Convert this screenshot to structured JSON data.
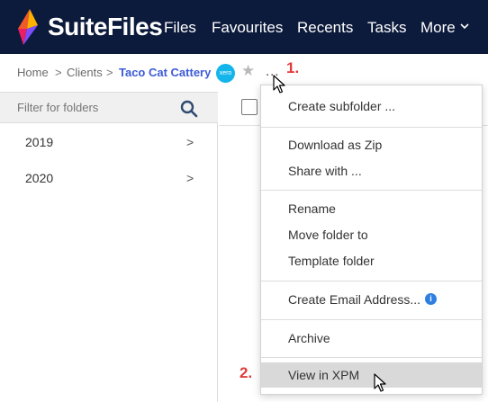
{
  "app": {
    "name": "SuiteFiles"
  },
  "nav": {
    "files": "Files",
    "favourites": "Favourites",
    "recents": "Recents",
    "tasks": "Tasks",
    "more": "More"
  },
  "breadcrumb": {
    "home": "Home",
    "clients": "Clients",
    "current": "Taco Cat Cattery",
    "separator": ">",
    "xero_badge": "xero",
    "more_dots": "..."
  },
  "annotations": {
    "step1": "1.",
    "step2": "2."
  },
  "filter": {
    "placeholder": "Filter for folders"
  },
  "folders": [
    {
      "label": "2019",
      "chevron": ">"
    },
    {
      "label": "2020",
      "chevron": ">"
    }
  ],
  "context_menu": {
    "create_subfolder": "Create subfolder ...",
    "download_zip": "Download as Zip",
    "share_with": "Share with ...",
    "rename": "Rename",
    "move_folder": "Move folder to",
    "template_folder": "Template folder",
    "create_email": "Create Email Address...",
    "info_glyph": "i",
    "archive": "Archive",
    "view_in_xpm": "View in XPM"
  },
  "colors": {
    "topbar": "#0c1a3c",
    "accent_link": "#3c5bd6",
    "annotation": "#e23b3b",
    "highlight": "#d9d9d9",
    "info": "#2f7fe3"
  }
}
